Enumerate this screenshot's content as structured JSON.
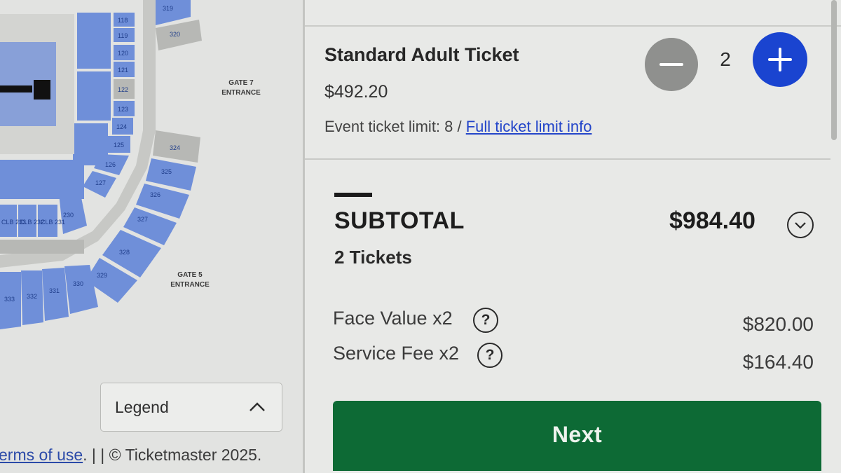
{
  "seat_map": {
    "sections": [
      {
        "id": "319"
      },
      {
        "id": "320"
      },
      {
        "id": "324"
      },
      {
        "id": "325"
      },
      {
        "id": "326"
      },
      {
        "id": "327"
      },
      {
        "id": "328"
      },
      {
        "id": "329"
      },
      {
        "id": "330"
      },
      {
        "id": "331"
      },
      {
        "id": "332"
      },
      {
        "id": "333"
      },
      {
        "id": "118"
      },
      {
        "id": "119"
      },
      {
        "id": "120"
      },
      {
        "id": "121"
      },
      {
        "id": "122"
      },
      {
        "id": "123"
      },
      {
        "id": "124"
      },
      {
        "id": "125"
      },
      {
        "id": "126"
      },
      {
        "id": "127"
      },
      {
        "id": "CLB 233"
      },
      {
        "id": "CLB 232"
      },
      {
        "id": "CLB 231"
      },
      {
        "id": "230"
      }
    ],
    "gates": {
      "gate7_line1": "GATE 7",
      "gate7_line2": "ENTRANCE",
      "gate5_line1": "GATE 5",
      "gate5_line2": "ENTRANCE"
    },
    "colors": {
      "available": "#6f8fd9",
      "unavailable": "#b7b8b5",
      "stage": "#111111"
    }
  },
  "legend": {
    "label": "Legend",
    "icon": "chevron-up-icon"
  },
  "footer": {
    "terms_link": "erms of use",
    "rest": ". | | © Ticketmaster 2025."
  },
  "ticket": {
    "name": "Standard Adult Ticket",
    "price": "$492.20",
    "quantity": "2",
    "limit_text": "Event ticket limit: 8 / ",
    "limit_link": "Full ticket limit info",
    "minus_icon": "minus-icon",
    "plus_icon": "plus-icon"
  },
  "summary": {
    "subtotal_label": "SUBTOTAL",
    "subtotal_amount": "$984.40",
    "ticket_count": "2 Tickets",
    "fees": [
      {
        "label": "Face Value x2",
        "amount": "$820.00",
        "icon": "help-icon"
      },
      {
        "label": "Service Fee x2",
        "amount": "$164.40",
        "icon": "help-icon"
      }
    ]
  },
  "next_button": {
    "label": "Next"
  },
  "colors": {
    "accent_blue": "#1a44d0",
    "next_green": "#0d6a35",
    "link_blue": "#2345c9"
  }
}
